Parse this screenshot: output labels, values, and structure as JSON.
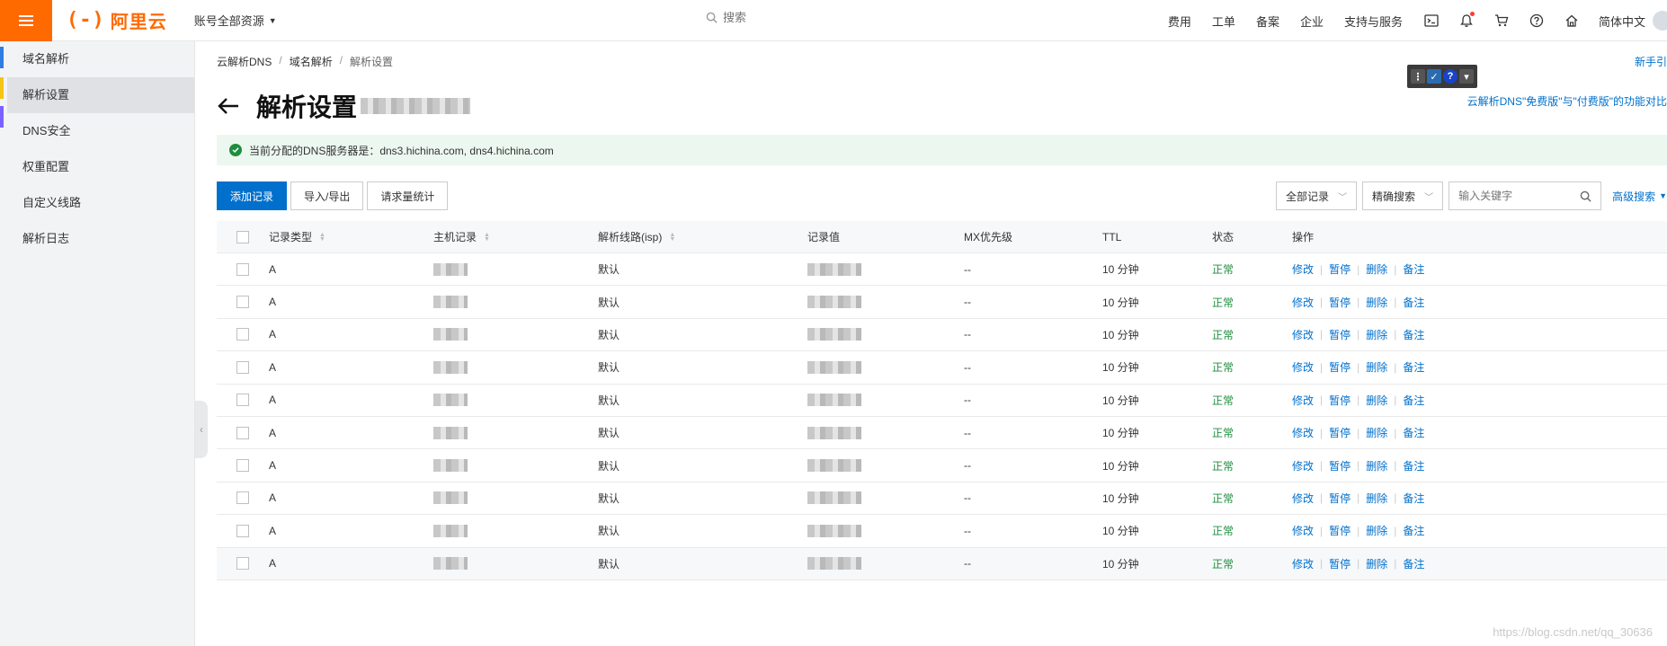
{
  "topbar": {
    "logo_text": "阿里云",
    "logo_mark": "(-)",
    "account_label": "账号全部资源",
    "search_placeholder": "搜索",
    "nav_items": [
      "费用",
      "工单",
      "备案",
      "企业",
      "支持与服务"
    ],
    "language": "简体中文"
  },
  "sidebar": {
    "items": [
      "域名解析",
      "解析设置",
      "DNS安全",
      "权重配置",
      "自定义线路",
      "解析日志"
    ],
    "active_index": 1
  },
  "breadcrumb": [
    "云解析DNS",
    "域名解析",
    "解析设置"
  ],
  "guide_link": "新手引",
  "page_title": "解析设置",
  "compare_link": "云解析DNS\"免费版\"与\"付费版\"的功能对比",
  "notice": "当前分配的DNS服务器是：dns3.hichina.com, dns4.hichina.com",
  "actions": {
    "add": "添加记录",
    "import_export": "导入/导出",
    "stats": "请求量统计"
  },
  "filters": {
    "record_filter": "全部记录",
    "search_mode": "精确搜索",
    "keyword_placeholder": "输入关键字",
    "advanced": "高级搜索"
  },
  "table": {
    "headers": [
      "记录类型",
      "主机记录",
      "解析线路(isp)",
      "记录值",
      "MX优先级",
      "TTL",
      "状态",
      "操作"
    ],
    "rows": [
      {
        "type": "A",
        "line": "默认",
        "mx": "--",
        "ttl": "10 分钟",
        "status": "正常"
      },
      {
        "type": "A",
        "line": "默认",
        "mx": "--",
        "ttl": "10 分钟",
        "status": "正常"
      },
      {
        "type": "A",
        "line": "默认",
        "mx": "--",
        "ttl": "10 分钟",
        "status": "正常"
      },
      {
        "type": "A",
        "line": "默认",
        "mx": "--",
        "ttl": "10 分钟",
        "status": "正常"
      },
      {
        "type": "A",
        "line": "默认",
        "mx": "--",
        "ttl": "10 分钟",
        "status": "正常"
      },
      {
        "type": "A",
        "line": "默认",
        "mx": "--",
        "ttl": "10 分钟",
        "status": "正常"
      },
      {
        "type": "A",
        "line": "默认",
        "mx": "--",
        "ttl": "10 分钟",
        "status": "正常"
      },
      {
        "type": "A",
        "line": "默认",
        "mx": "--",
        "ttl": "10 分钟",
        "status": "正常"
      },
      {
        "type": "A",
        "line": "默认",
        "mx": "--",
        "ttl": "10 分钟",
        "status": "正常"
      },
      {
        "type": "A",
        "line": "默认",
        "mx": "--",
        "ttl": "10 分钟",
        "status": "正常"
      }
    ],
    "ops": [
      "修改",
      "暂停",
      "删除",
      "备注"
    ]
  },
  "watermark": "https://blog.csdn.net/qq_30636",
  "colors": {
    "brand": "#ff6a00",
    "primary": "#0070cc",
    "success": "#1e8e3e",
    "notice_bg": "#ecf8ef"
  }
}
